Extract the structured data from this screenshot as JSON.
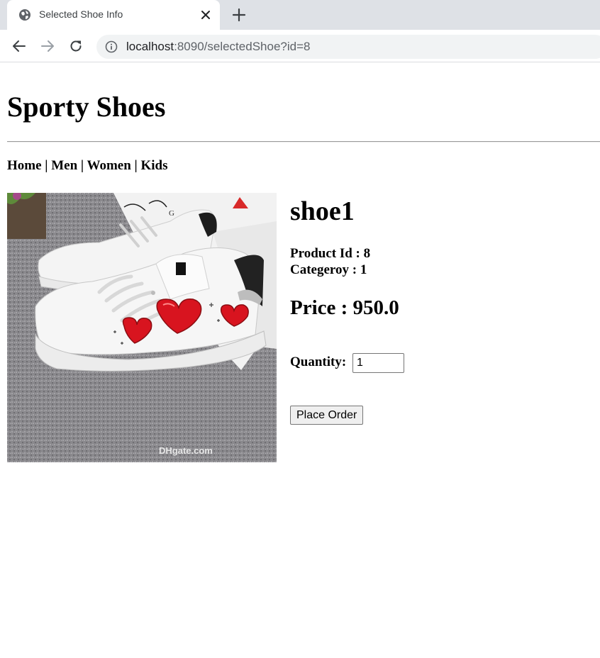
{
  "browser": {
    "tab_title": "Selected Shoe Info",
    "url_host": "localhost",
    "url_path": ":8090/selectedShoe?id=8",
    "icons": {
      "favicon": "globe-icon",
      "close": "close-icon",
      "new_tab": "plus-icon",
      "back": "back-arrow-icon",
      "forward": "forward-arrow-icon",
      "reload": "reload-icon",
      "site_info": "info-icon"
    }
  },
  "site": {
    "title": "Sporty Shoes"
  },
  "nav": {
    "items": [
      "Home",
      "Men",
      "Women",
      "Kids"
    ],
    "separator": " | "
  },
  "product": {
    "name": "shoe1",
    "id_line": "Product Id : 8",
    "category_line": "Categeroy : 1",
    "price_line": "Price : 950.0",
    "quantity_label": "Quantity:",
    "quantity_value": "1",
    "order_button": "Place Order",
    "image_watermark": "DHgate.com"
  },
  "colors": {
    "chrome_bg": "#dee1e6",
    "omnibox_bg": "#f1f3f4",
    "heart_red": "#d8141f"
  }
}
